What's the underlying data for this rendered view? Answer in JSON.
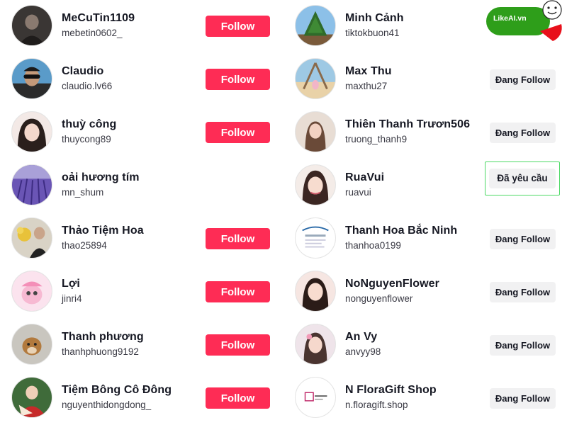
{
  "left_users": [
    {
      "name": "MeCuTin1109",
      "handle": "mebetin0602_",
      "button": "Follow",
      "avatar_icon": "person-in-dark-photo-avatar"
    },
    {
      "name": "Claudio",
      "handle": "claudio.lv66",
      "button": "Follow",
      "avatar_icon": "man-with-sunglasses-avatar"
    },
    {
      "name": "thuỳ công",
      "handle": "thuycong89",
      "button": "Follow",
      "avatar_icon": "girl-portrait-avatar"
    },
    {
      "name": "oải hương tím",
      "handle": "mn_shum",
      "button": "",
      "avatar_icon": "lavender-field-avatar"
    },
    {
      "name": "Thảo Tiệm Hoa",
      "handle": "thao25894",
      "button": "Follow",
      "avatar_icon": "woman-with-flowers-avatar"
    },
    {
      "name": "Lợi",
      "handle": "jinri4",
      "button": "Follow",
      "avatar_icon": "candy-slimey-cartoon-avatar"
    },
    {
      "name": "Thanh phương",
      "handle": "thanhphuong9192",
      "button": "Follow",
      "avatar_icon": "puppy-avatar"
    },
    {
      "name": "Tiệm Bông Cô Đông",
      "handle": "nguyenthidongdong_",
      "button": "Follow",
      "avatar_icon": "woman-in-red-avatar"
    }
  ],
  "right_users": [
    {
      "name": "Minh Cảnh",
      "handle": "tiktokbuon41",
      "button": "",
      "avatar_icon": "tree-avatar"
    },
    {
      "name": "Max Thu",
      "handle": "maxthu27",
      "button": "Đang Follow",
      "avatar_icon": "beach-swing-avatar"
    },
    {
      "name": "Thiên Thanh Trươn506",
      "handle": "truong_thanh9",
      "button": "Đang Follow",
      "avatar_icon": "woman-portrait-avatar"
    },
    {
      "name": "RuaVui",
      "handle": "ruavui",
      "button": "Đã yêu cầu",
      "avatar_icon": "girl-selfie-avatar"
    },
    {
      "name": "Thanh Hoa Bắc Ninh",
      "handle": "thanhoa0199",
      "button": "Đang Follow",
      "avatar_icon": "shop-logo-avatar"
    },
    {
      "name": "NoNguyenFlower",
      "handle": "nonguyenflower",
      "button": "Đang Follow",
      "avatar_icon": "girl-portrait-avatar"
    },
    {
      "name": "An Vy",
      "handle": "anvyy98",
      "button": "Đang Follow",
      "avatar_icon": "girl-portrait-avatar"
    },
    {
      "name": "N FloraGift Shop",
      "handle": "n.floragift.shop",
      "button": "Đang Follow",
      "avatar_icon": "flora-gift-logo-avatar"
    }
  ],
  "badge": {
    "label": "LikeAI.vn",
    "icon": "smiley-face-icon"
  },
  "colors": {
    "follow": "#fe2c55",
    "following_bg": "#f1f1f2",
    "requested_border": "#4cd964",
    "badge_green": "#2e9e1a",
    "badge_red": "#e8101b"
  }
}
